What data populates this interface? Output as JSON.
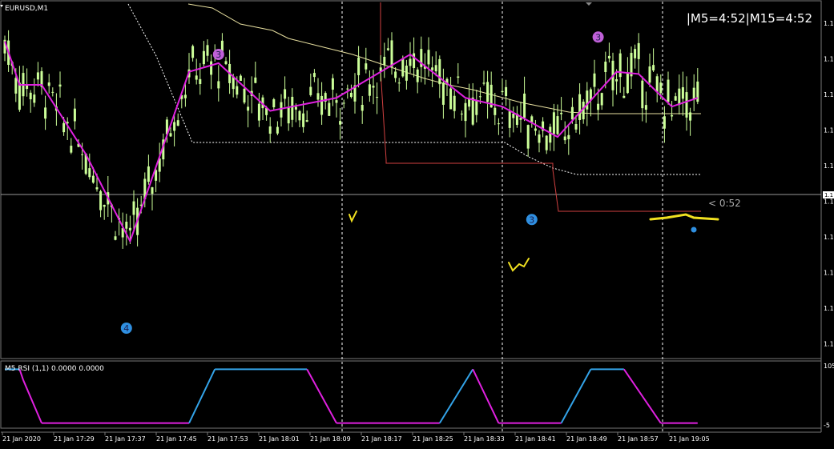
{
  "chart_data": [
    {
      "type": "candlestick",
      "symbol_label": "EURUSD,M1",
      "timer_label": "|M5=4:52|M15=4:52",
      "countdown_label": "< 0:52",
      "price_label": "1.1",
      "y_tick_labels": [
        "1.1",
        "1.1",
        "1.1",
        "1.1",
        "1.1",
        "1.1",
        "1.1",
        "1.1",
        "1.1",
        "1.1"
      ],
      "x_tick_labels": [
        "21 Jan 2020",
        "21 Jan 17:29",
        "21 Jan 17:37",
        "21 Jan 17:45",
        "21 Jan 17:53",
        "21 Jan 18:01",
        "21 Jan 18:09",
        "21 Jan 18:17",
        "21 Jan 18:25",
        "21 Jan 18:33",
        "21 Jan 18:41",
        "21 Jan 18:49",
        "21 Jan 18:57",
        "21 Jan 19:05"
      ],
      "zigzag": [
        [
          0,
          92
        ],
        [
          4,
          72
        ],
        [
          10,
          72
        ],
        [
          22,
          40
        ],
        [
          34,
          0
        ],
        [
          50,
          78
        ],
        [
          58,
          82
        ],
        [
          72,
          60
        ],
        [
          90,
          66
        ],
        [
          110,
          86
        ],
        [
          125,
          66
        ],
        [
          135,
          62
        ],
        [
          150,
          48
        ],
        [
          166,
          78
        ],
        [
          172,
          77
        ],
        [
          181,
          62
        ],
        [
          188,
          66
        ]
      ],
      "zigzag_color": "#e020e0",
      "markers": [
        {
          "label": "3",
          "bar": 58,
          "value": 86,
          "color": "#c060d8"
        },
        {
          "label": "4",
          "bar": 33,
          "value": -40,
          "color": "#2f8fe0"
        },
        {
          "label": "3",
          "bar": 143,
          "value": 10,
          "color": "#2f8fe0"
        },
        {
          "label": "3",
          "bar": 161,
          "value": 94,
          "color": "#c060d8"
        }
      ],
      "candle_up_color": "#ccff99",
      "candle_down_color": "#ccff99",
      "grid": false
    },
    {
      "type": "line",
      "title": "M5 RSI (1,1) 0.0000 0.0000",
      "y_tick_labels": [
        "105",
        "-5"
      ],
      "ylim": [
        -5,
        105
      ],
      "points": [
        [
          0,
          100
        ],
        [
          4,
          100
        ],
        [
          5,
          80
        ],
        [
          10,
          0
        ],
        [
          50,
          0
        ],
        [
          57,
          100
        ],
        [
          82,
          100
        ],
        [
          90,
          0
        ],
        [
          118,
          0
        ],
        [
          127,
          100
        ],
        [
          134,
          0
        ],
        [
          151,
          0
        ],
        [
          159,
          100
        ],
        [
          168,
          100
        ],
        [
          178,
          0
        ],
        [
          188,
          0
        ]
      ],
      "rising_color": "#33a3e8",
      "falling_color": "#e020e0"
    }
  ]
}
